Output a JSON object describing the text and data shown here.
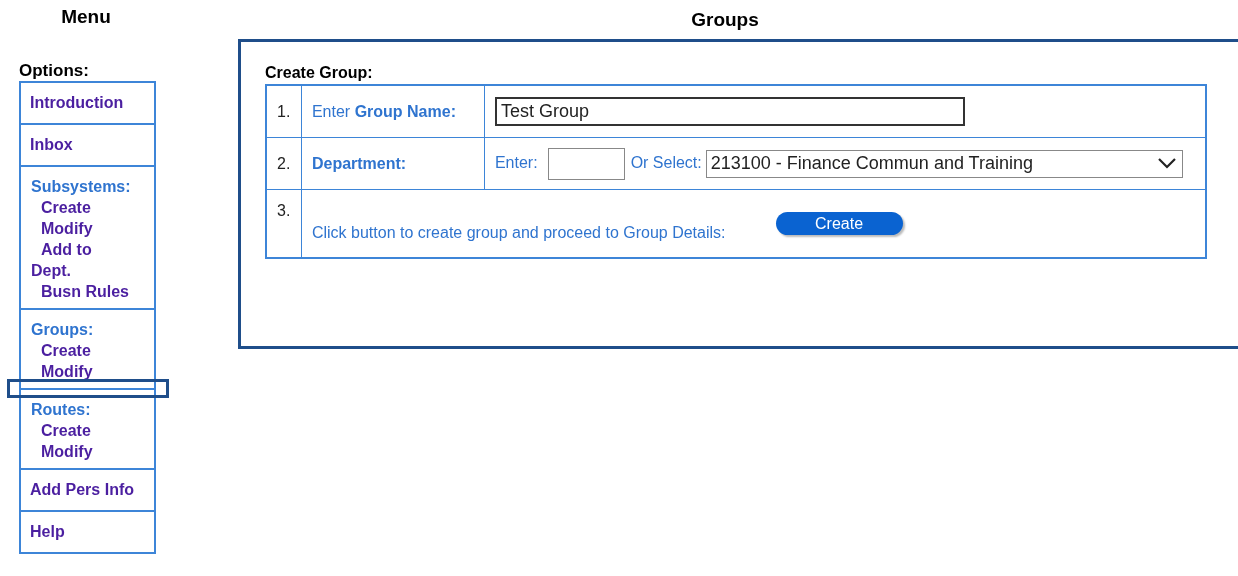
{
  "menu": {
    "title": "Menu",
    "options_label": "Options:",
    "items": [
      {
        "kind": "link",
        "label": "Introduction"
      },
      {
        "kind": "link",
        "label": "Inbox"
      },
      {
        "kind": "section",
        "heading": "Subsystems:",
        "links": [
          "Create",
          "Modify",
          "Add to Dept.",
          "Busn Rules"
        ]
      },
      {
        "kind": "section",
        "heading": "Groups:",
        "links": [
          "Create",
          "Modify"
        ]
      },
      {
        "kind": "section",
        "heading": "Routes:",
        "links": [
          "Create",
          "Modify"
        ]
      },
      {
        "kind": "link",
        "label": "Add Pers Info"
      },
      {
        "kind": "link",
        "label": "Help"
      }
    ]
  },
  "page_title": "Groups",
  "form": {
    "title": "Create Group:",
    "rows": [
      {
        "kind": "text",
        "number": "1.",
        "label": "Enter Group Name",
        "colon": ":",
        "value": "Test Group"
      },
      {
        "kind": "department",
        "number": "2.",
        "label": "Department",
        "colon": ":",
        "enter_label": "Enter:",
        "select_label": "Or Select:",
        "select_value": "213100 - Finance Commun and Training"
      },
      {
        "kind": "action",
        "number": "3.",
        "text": "Click button to create group and proceed to Group Details:",
        "button": "Create"
      }
    ]
  }
}
